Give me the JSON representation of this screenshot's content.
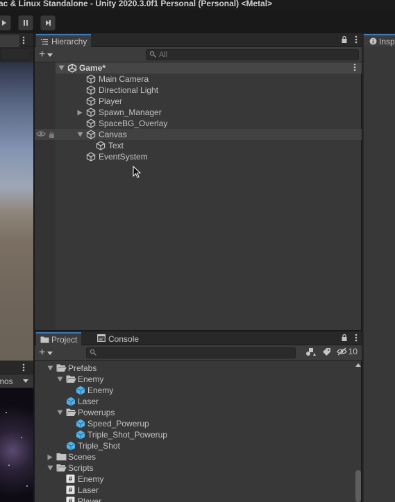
{
  "window": {
    "title": "ac & Linux Standalone - Unity 2020.3.0f1 Personal (Personal) <Metal>"
  },
  "toolbar": {
    "play_icon": "play-icon",
    "pause_icon": "pause-icon",
    "step_icon": "step-icon"
  },
  "scene_view": {
    "gizmos_label": "mos"
  },
  "hierarchy": {
    "tab_label": "Hierarchy",
    "search_placeholder": "All",
    "scene_name": "Game*",
    "items": [
      {
        "label": "Main Camera",
        "depth": 1,
        "expander": "none",
        "selected": false
      },
      {
        "label": "Directional Light",
        "depth": 1,
        "expander": "none",
        "selected": false
      },
      {
        "label": "Player",
        "depth": 1,
        "expander": "none",
        "selected": false
      },
      {
        "label": "Spawn_Manager",
        "depth": 1,
        "expander": "collapsed",
        "selected": false
      },
      {
        "label": "SpaceBG_Overlay",
        "depth": 1,
        "expander": "none",
        "selected": false
      },
      {
        "label": "Canvas",
        "depth": 1,
        "expander": "expanded",
        "selected": true
      },
      {
        "label": "Text",
        "depth": 2,
        "expander": "none",
        "selected": false
      },
      {
        "label": "EventSystem",
        "depth": 1,
        "expander": "none",
        "selected": false
      }
    ]
  },
  "inspector": {
    "tab_label": "Insp"
  },
  "project": {
    "tab_label": "Project",
    "console_tab_label": "Console",
    "search_value": "",
    "hidden_count": "10",
    "items": [
      {
        "label": "Prefabs",
        "depth": 0,
        "kind": "folder-open",
        "expander": "expanded"
      },
      {
        "label": "Enemy",
        "depth": 1,
        "kind": "folder-open",
        "expander": "expanded"
      },
      {
        "label": "Enemy",
        "depth": 2,
        "kind": "prefab",
        "expander": "none"
      },
      {
        "label": "Laser",
        "depth": 1,
        "kind": "prefab",
        "expander": "none"
      },
      {
        "label": "Powerups",
        "depth": 1,
        "kind": "folder-open",
        "expander": "expanded"
      },
      {
        "label": "Speed_Powerup",
        "depth": 2,
        "kind": "prefab",
        "expander": "none"
      },
      {
        "label": "Triple_Shot_Powerup",
        "depth": 2,
        "kind": "prefab",
        "expander": "none"
      },
      {
        "label": "Triple_Shot",
        "depth": 1,
        "kind": "prefab",
        "expander": "none"
      },
      {
        "label": "Scenes",
        "depth": 0,
        "kind": "folder",
        "expander": "collapsed"
      },
      {
        "label": "Scripts",
        "depth": 0,
        "kind": "folder-open",
        "expander": "expanded"
      },
      {
        "label": "Enemy",
        "depth": 1,
        "kind": "script",
        "expander": "none"
      },
      {
        "label": "Laser",
        "depth": 1,
        "kind": "script",
        "expander": "none"
      },
      {
        "label": "Player",
        "depth": 1,
        "kind": "script",
        "expander": "none"
      }
    ]
  },
  "colors": {
    "accent": "#3a79bb",
    "prefab": "#4fb3ec",
    "panel": "#383838",
    "selected_row": "#414141"
  }
}
